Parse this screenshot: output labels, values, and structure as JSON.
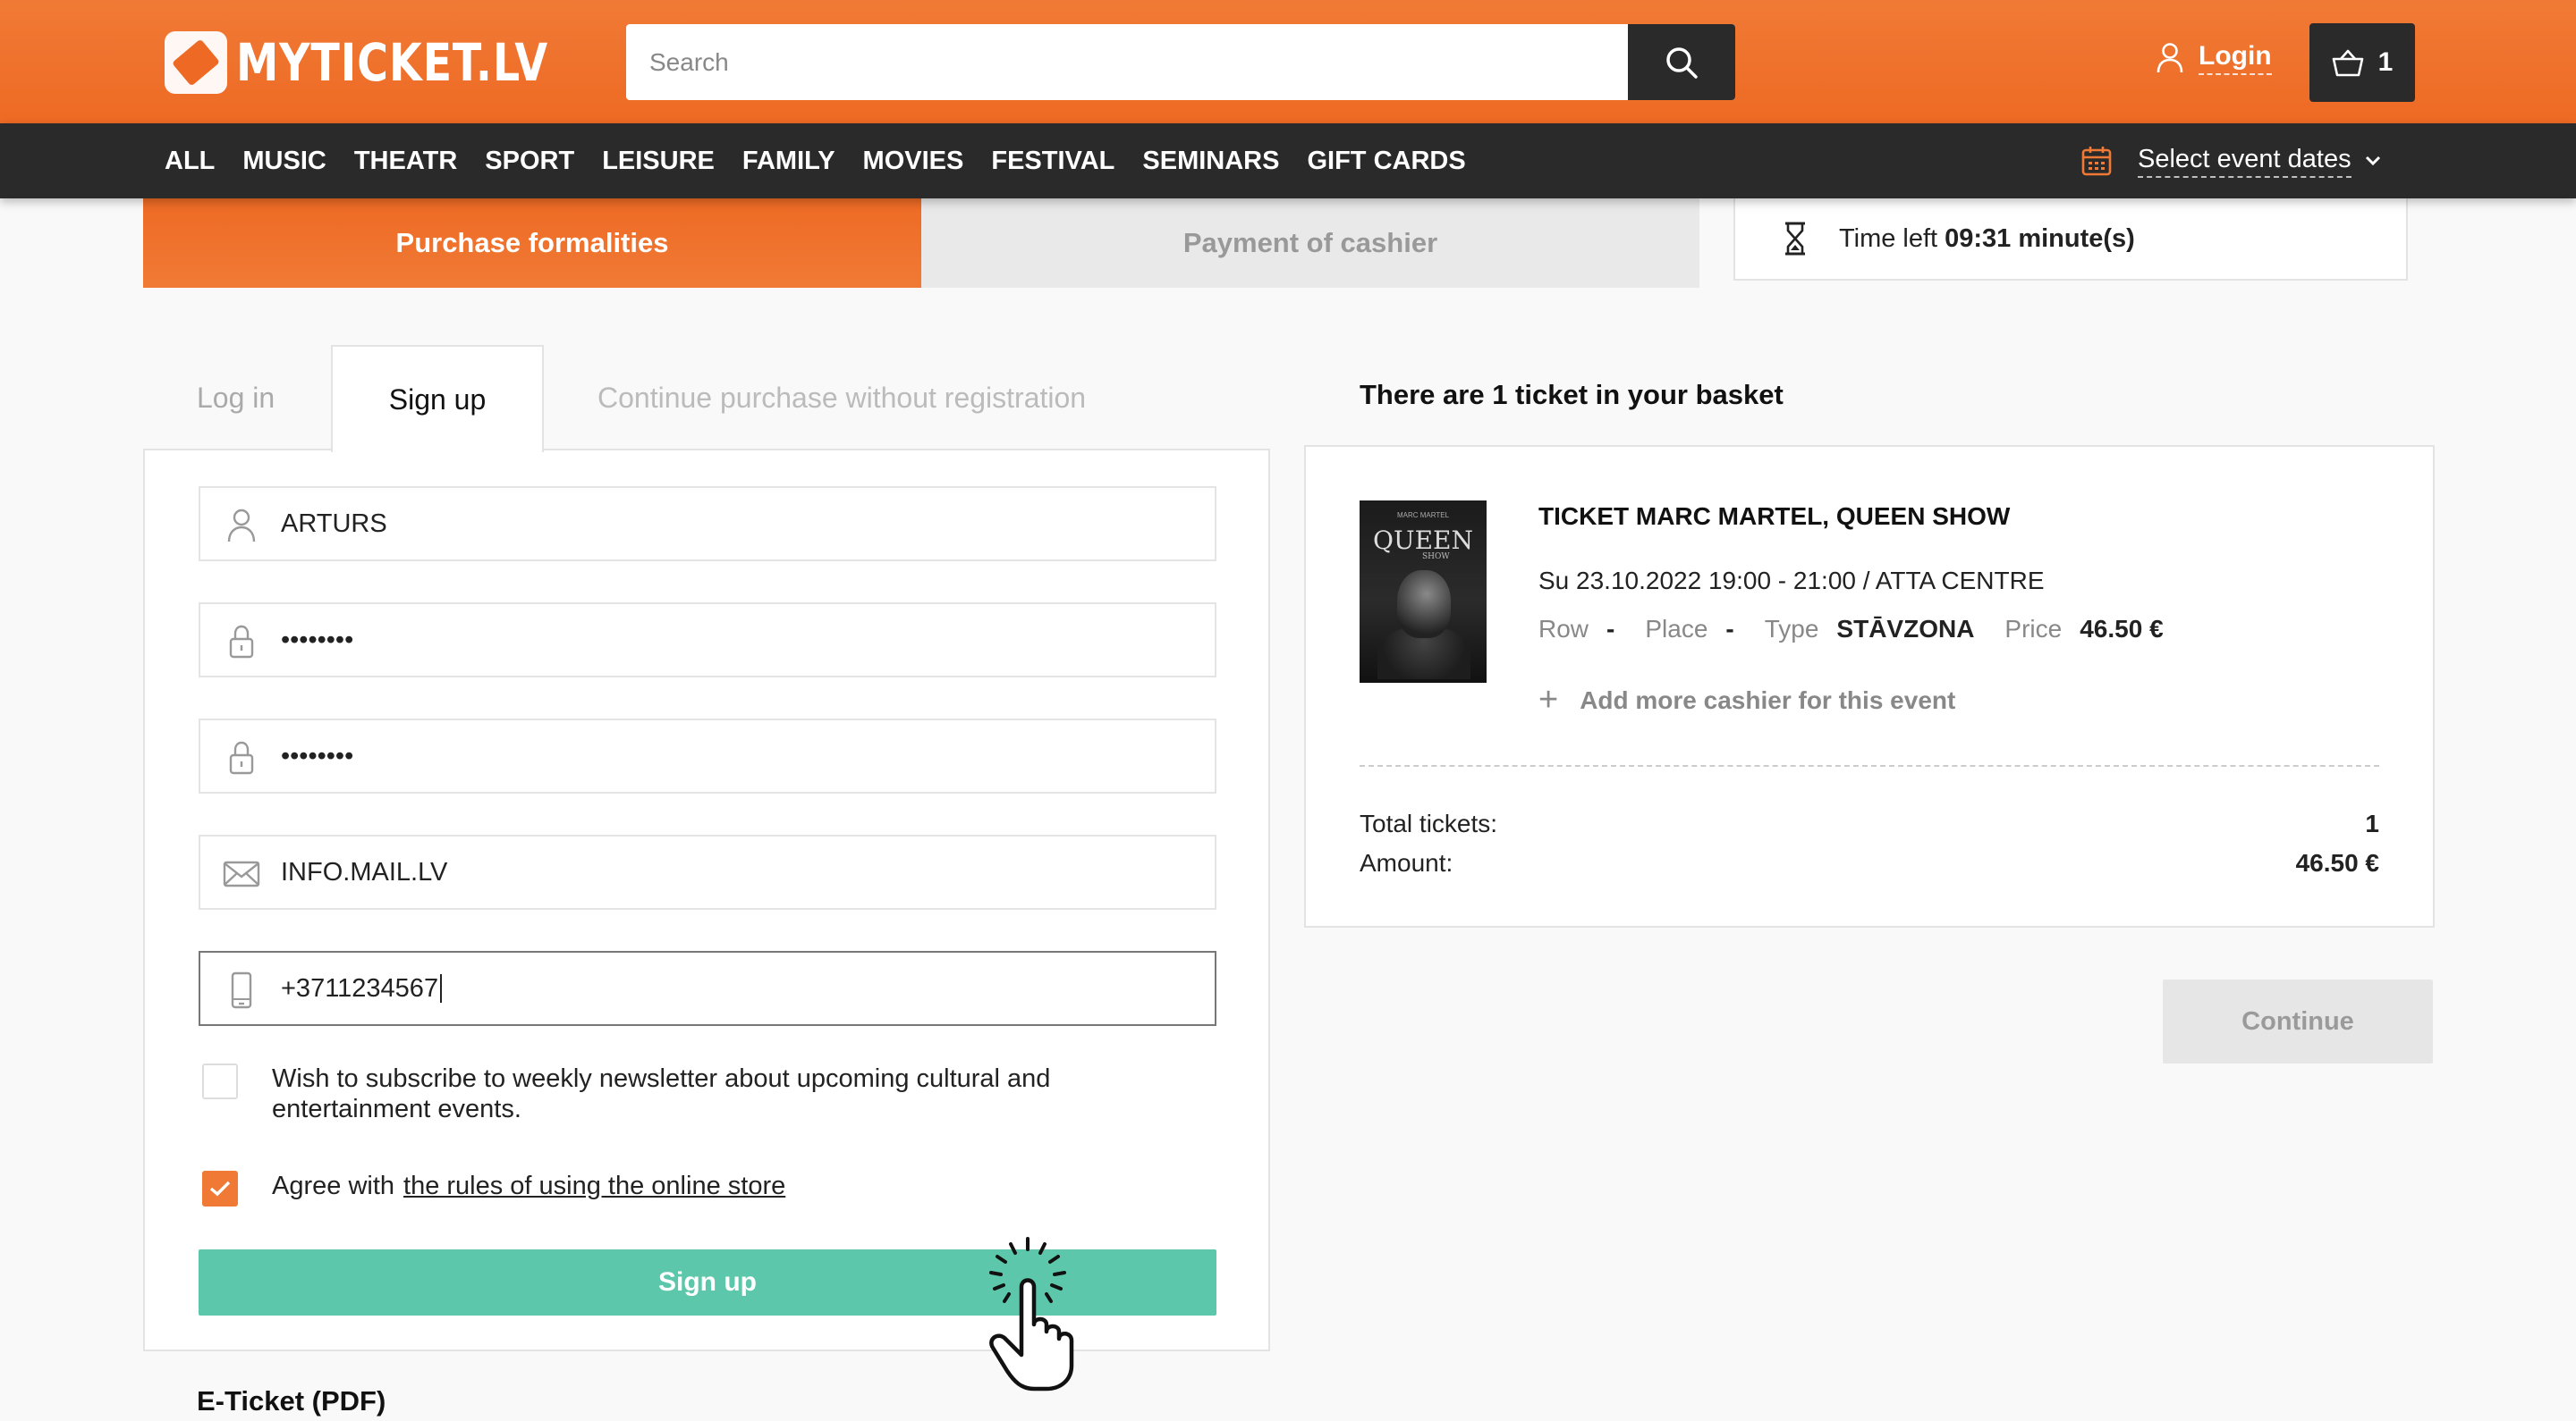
{
  "header": {
    "logo_text": "MYTICKET.LV",
    "search_placeholder": "Search",
    "login_label": "Login",
    "cart_count": "1"
  },
  "nav": {
    "items": [
      "ALL",
      "MUSIC",
      "THEATR",
      "SPORT",
      "LEISURE",
      "FAMILY",
      "MOVIES",
      "FESTIVAL",
      "SEMINARS",
      "GIFT CARDS"
    ],
    "dates_label": "Select event dates"
  },
  "steps": {
    "active": "Purchase formalities",
    "inactive": "Payment of cashier"
  },
  "timer": {
    "label": "Time left",
    "value": "09:31 minute(s)"
  },
  "tabs": {
    "login": "Log in",
    "signup": "Sign up",
    "guest": "Continue purchase without registration"
  },
  "form": {
    "name": "ARTURS",
    "password": "••••••••",
    "password_repeat": "••••••••",
    "email": "INFO.MAIL.LV",
    "phone": "+3711234567",
    "newsletter_label": "Wish to subscribe to weekly newsletter about upcoming cultural and entertainment events.",
    "newsletter_checked": false,
    "agree_prefix": "Agree with",
    "agree_link": "the rules of using the online store",
    "agree_checked": true,
    "submit_label": "Sign up"
  },
  "eticket_label": "E-Ticket (PDF)",
  "basket": {
    "title": "There are 1 ticket in your basket",
    "ticket": {
      "title": "TICKET MARC MARTEL, QUEEN SHOW",
      "poster_title": "QUEEN",
      "poster_top": "MARC MARTEL",
      "poster_sub": "SHOW",
      "datetime": "Su 23.10.2022 19:00 - 21:00 / ATTA CENTRE",
      "row_label": "Row",
      "row_value": "-",
      "place_label": "Place",
      "place_value": "-",
      "type_label": "Type",
      "type_value": "STĀVZONA",
      "price_label": "Price",
      "price_value": "46.50 €"
    },
    "add_more": "Add more cashier for this event",
    "total_label": "Total tickets:",
    "total_value": "1",
    "amount_label": "Amount:",
    "amount_value": "46.50 €"
  },
  "continue_label": "Continue",
  "colors": {
    "accent": "#ee6a24",
    "dark": "#2a2a2a",
    "signup": "#5cc7aa"
  }
}
